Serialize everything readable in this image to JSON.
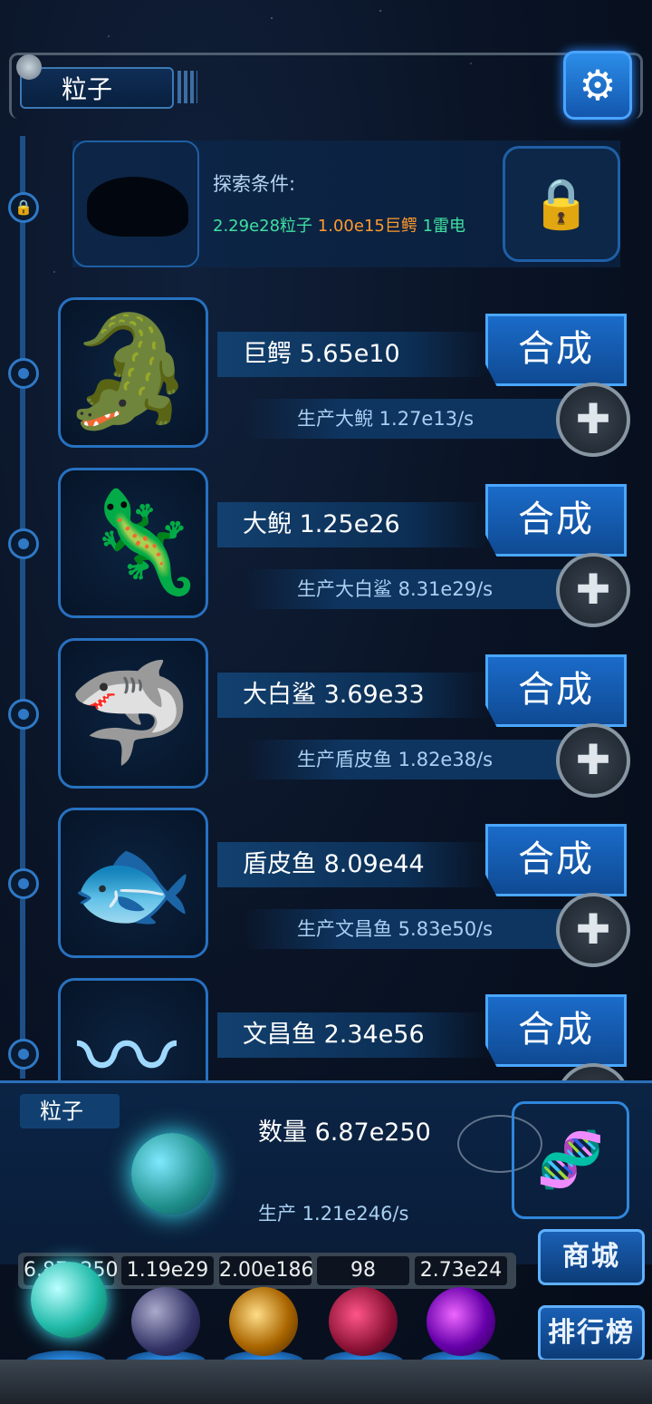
{
  "header": {
    "tab_label": "粒子",
    "settings_icon": "gear-icon"
  },
  "explore": {
    "title": "探索条件:",
    "req1": "2.29e28粒子",
    "req2": "1.00e15巨鳄",
    "req3": "1雷电",
    "lock_icon": "lock-icon"
  },
  "creatures": [
    {
      "name": "巨鳄 5.65e10",
      "prod": "生产大鲵 1.27e13/s",
      "merge": "合成",
      "glyph": "🐊"
    },
    {
      "name": "大鲵 1.25e26",
      "prod": "生产大白鲨 8.31e29/s",
      "merge": "合成",
      "glyph": "🦎"
    },
    {
      "name": "大白鲨 3.69e33",
      "prod": "生产盾皮鱼 1.82e38/s",
      "merge": "合成",
      "glyph": "🦈"
    },
    {
      "name": "盾皮鱼 8.09e44",
      "prod": "生产文昌鱼 5.83e50/s",
      "merge": "合成",
      "glyph": "🐟"
    },
    {
      "name": "文昌鱼 2.34e56",
      "prod": "",
      "merge": "合成",
      "glyph": "〰"
    }
  ],
  "particle_panel": {
    "label": "粒子",
    "count": "数量 6.87e250",
    "prod": "生产 1.21e246/s"
  },
  "resources": [
    "6.87e250",
    "1.19e29",
    "2.00e186",
    "98",
    "2.73e24"
  ],
  "side_buttons": {
    "shop": "商城",
    "rank": "排行榜"
  },
  "colors": {
    "accent": "#2b8de8",
    "green": "#3fe0a0",
    "orange": "#ff9a2e"
  }
}
